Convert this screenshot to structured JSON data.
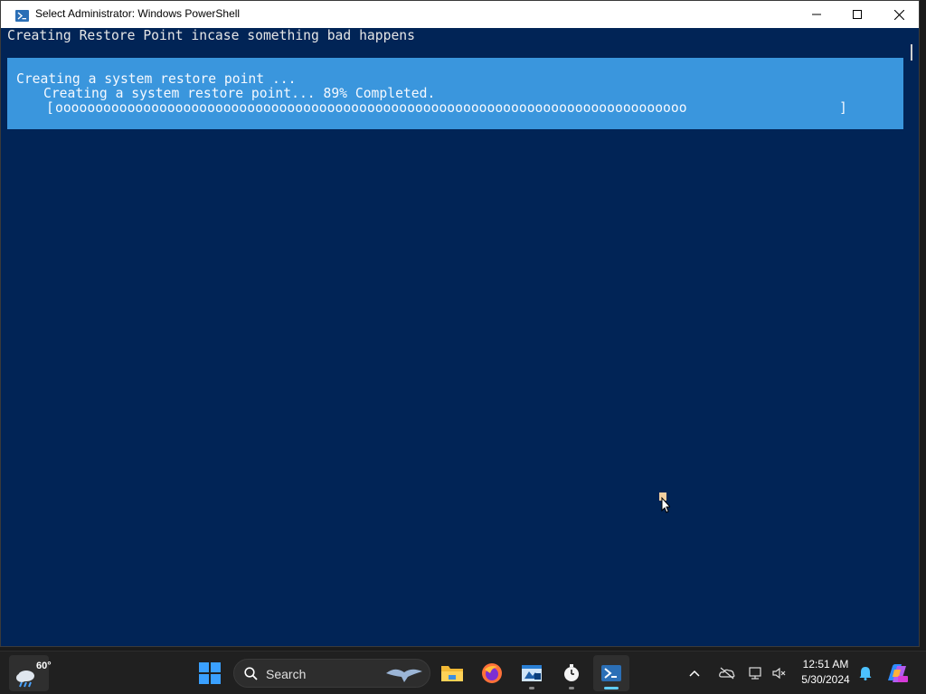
{
  "window": {
    "title": "Select Administrator: Windows PowerShell"
  },
  "console": {
    "header_line": "Creating Restore Point incase something bad happens",
    "progress": {
      "activity": "Creating a system restore point ...",
      "status": "Creating a system restore point... 89% Completed.",
      "percent": 89,
      "bar_open": "[",
      "bar_fill": "ooooooooooooooooooooooooooooooooooooooooooooooooooooooooooooooooooooooooooooooo",
      "bar_close": "]"
    }
  },
  "taskbar": {
    "weather_temp": "60°",
    "search_label": "Search",
    "time": "12:51 AM",
    "date": "5/30/2024",
    "apps": [
      {
        "name": "start",
        "icon": "windows-logo-icon"
      },
      {
        "name": "search",
        "icon": "search-icon"
      },
      {
        "name": "file-explorer",
        "icon": "folder-icon"
      },
      {
        "name": "firefox",
        "icon": "firefox-icon"
      },
      {
        "name": "app",
        "icon": "app-icon"
      },
      {
        "name": "clock",
        "icon": "stopwatch-icon"
      },
      {
        "name": "powershell",
        "icon": "powershell-icon"
      }
    ]
  },
  "colors": {
    "console_bg": "#012456",
    "progress_bg": "#3a96dd",
    "taskbar_bg": "#202020"
  }
}
